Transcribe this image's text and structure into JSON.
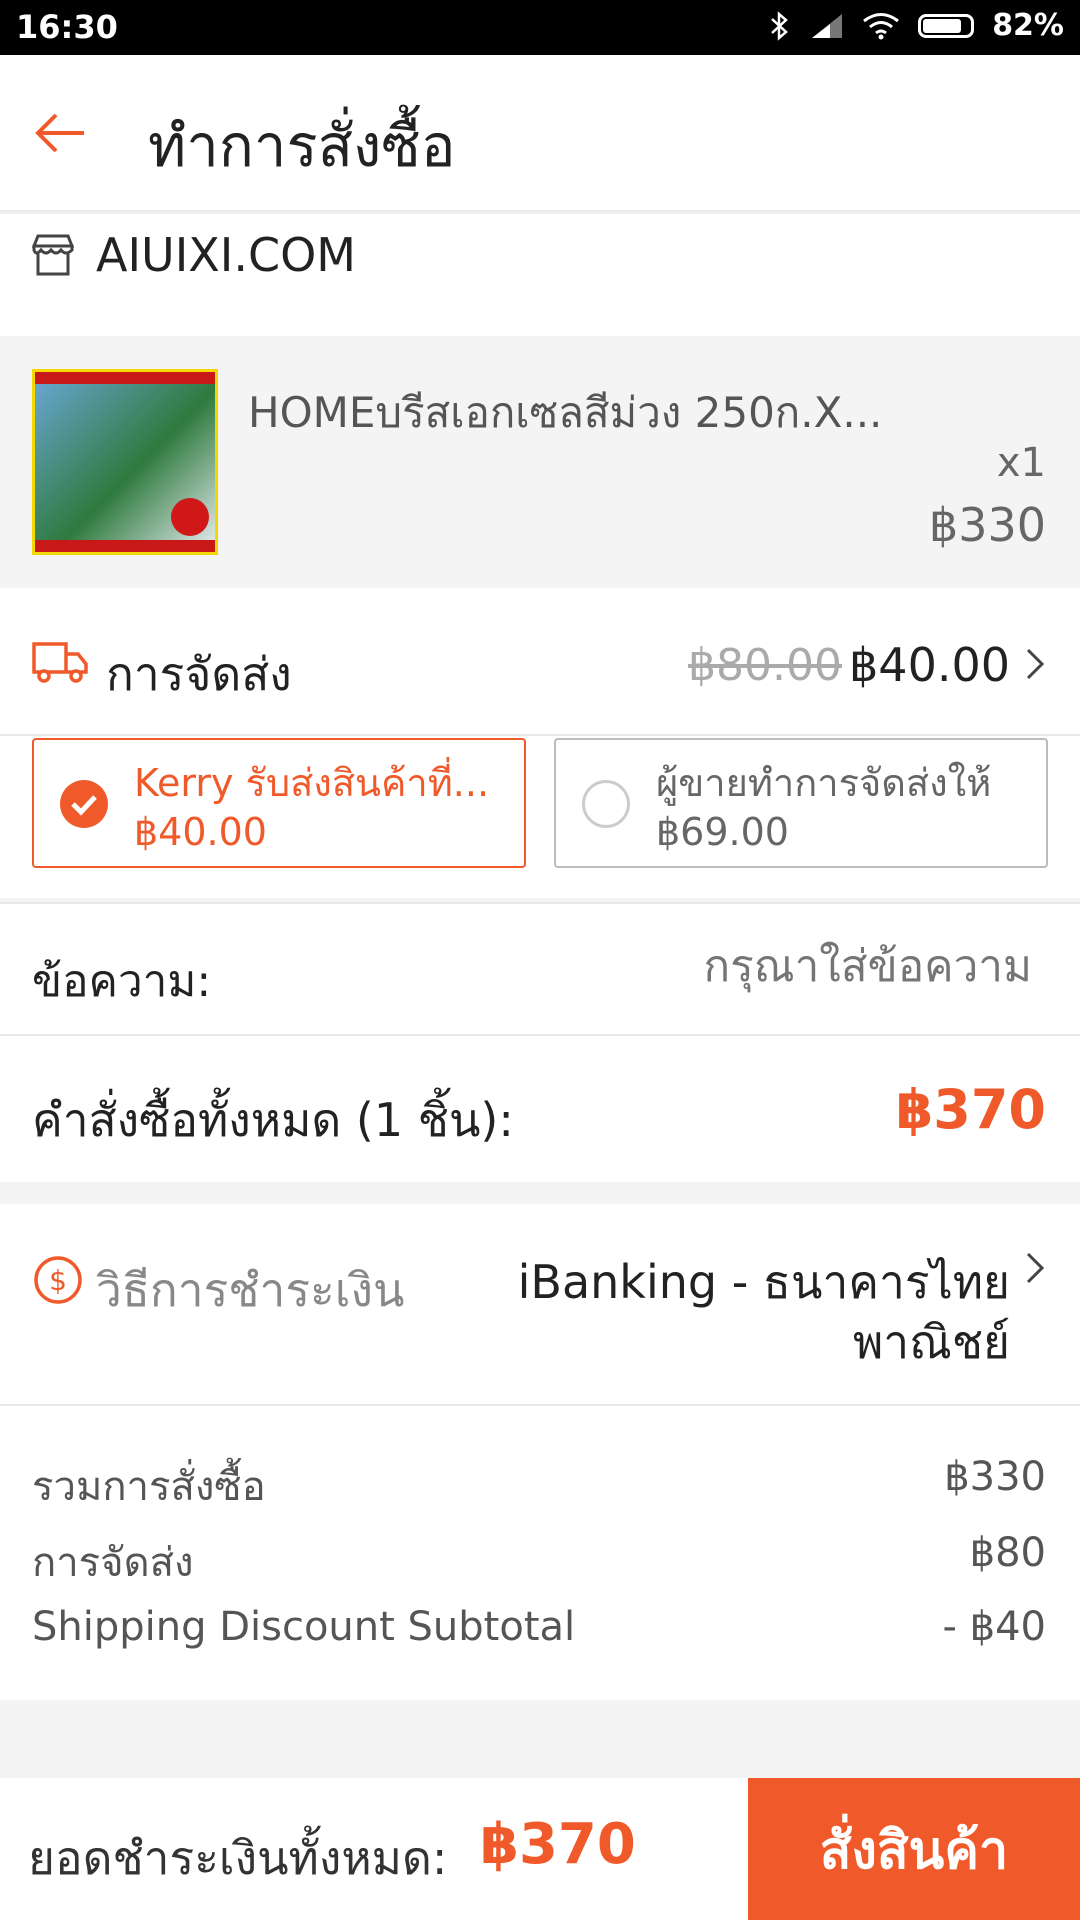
{
  "status": {
    "time": "16:30",
    "battery": "82%",
    "battery_level": 0.82
  },
  "header": {
    "title": "ทำการสั่งซื้อ"
  },
  "shop": {
    "name": "AIUIXI.COM"
  },
  "product": {
    "name": "HOMEบรีสเอกเซลสีม่วง 250ก.X...",
    "qty": "x1",
    "price": "฿330"
  },
  "shipping": {
    "label": "การจัดส่ง",
    "old_price": "฿80.00",
    "new_price": "฿40.00",
    "options": [
      {
        "title": "Kerry รับส่งสินค้าที่...",
        "price": "฿40.00",
        "selected": true
      },
      {
        "title": "ผู้ขายทำการจัดส่งให้",
        "price": "฿69.00",
        "selected": false
      }
    ]
  },
  "message": {
    "label": "ข้อความ:",
    "placeholder": "กรุณาใส่ข้อความ"
  },
  "order_total": {
    "label": "คำสั่งซื้อทั้งหมด (1 ชิ้น):",
    "value": "฿370"
  },
  "payment": {
    "label": "วิธีการชำระเงิน",
    "method_line1": "iBanking - ธนาคารไทย",
    "method_line2": "พาณิชย์"
  },
  "summary": [
    {
      "label": "รวมการสั่งซื้อ",
      "value": "฿330"
    },
    {
      "label": "การจัดส่ง",
      "value": "฿80"
    },
    {
      "label": "Shipping Discount Subtotal",
      "value": "- ฿40"
    }
  ],
  "footer": {
    "total_label": "ยอดชำระเงินทั้งหมด:",
    "total_value": "฿370",
    "order_button": "สั่งสินค้า"
  },
  "colors": {
    "accent": "#f05a2a"
  }
}
